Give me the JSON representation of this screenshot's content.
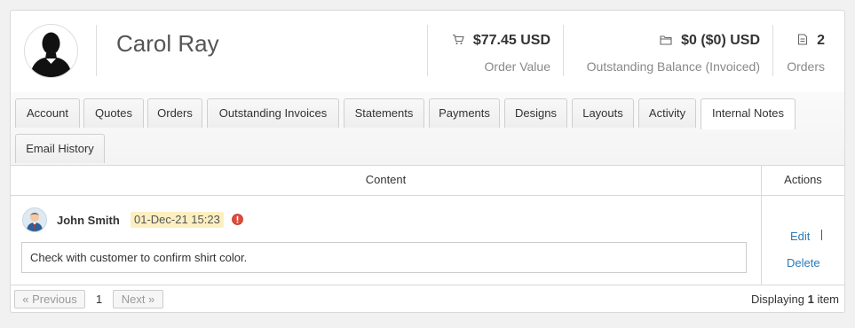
{
  "customer": {
    "name": "Carol Ray"
  },
  "stats": {
    "order_value": {
      "value": "$77.45 USD",
      "label": "Order Value"
    },
    "outstanding": {
      "value": "$0 ($0) USD",
      "label": "Outstanding Balance (Invoiced)"
    },
    "orders": {
      "value": "2",
      "label": "Orders"
    }
  },
  "tabs": [
    {
      "label": "Account"
    },
    {
      "label": "Quotes"
    },
    {
      "label": "Orders"
    },
    {
      "label": "Outstanding Invoices"
    },
    {
      "label": "Statements"
    },
    {
      "label": "Payments"
    },
    {
      "label": "Designs"
    },
    {
      "label": "Layouts"
    },
    {
      "label": "Activity"
    },
    {
      "label": "Internal Notes"
    },
    {
      "label": "Email History"
    }
  ],
  "active_tab": "Internal Notes",
  "table": {
    "headers": {
      "content": "Content",
      "actions": "Actions"
    },
    "rows": [
      {
        "author": "John Smith",
        "date": "01-Dec-21 15:23",
        "content": "Check with customer to confirm shirt color.",
        "edit_label": "Edit",
        "delete_label": "Delete"
      }
    ]
  },
  "pagination": {
    "prev_label": "« Previous",
    "current_page": "1",
    "next_label": "Next »",
    "display_prefix": "Displaying",
    "display_count": "1",
    "display_suffix": "item"
  },
  "colors": {
    "link": "#2a7ab8",
    "date_badge": "#fcefc1",
    "warning": "#e04b3b"
  }
}
